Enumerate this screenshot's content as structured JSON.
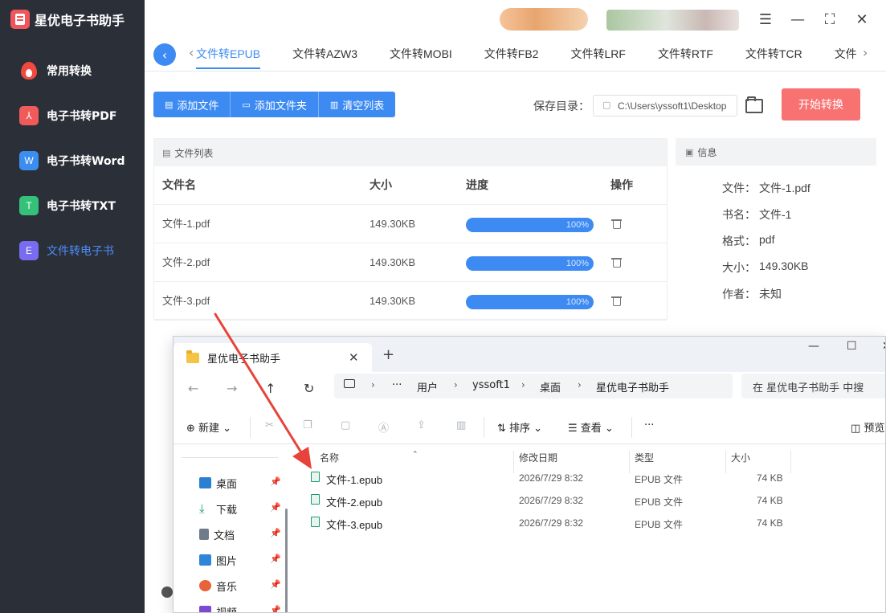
{
  "app": {
    "title": "星优电子书助手",
    "nav": [
      {
        "label": "常用转换",
        "icon": "fire-icon"
      },
      {
        "label": "电子书转PDF",
        "icon": "pdf-icon"
      },
      {
        "label": "电子书转Word",
        "icon": "word-icon",
        "glyph": "W"
      },
      {
        "label": "电子书转TXT",
        "icon": "txt-icon",
        "glyph": "T"
      },
      {
        "label": "文件转电子书",
        "icon": "ebook-icon",
        "glyph": "E",
        "active": true
      }
    ]
  },
  "tabs": [
    "文件转EPUB",
    "文件转AZW3",
    "文件转MOBI",
    "文件转FB2",
    "文件转LRF",
    "文件转RTF",
    "文件转TCR",
    "文件"
  ],
  "toolbar": {
    "add_file": "添加文件",
    "add_folder": "添加文件夹",
    "clear_list": "清空列表",
    "save_label": "保存目录：",
    "save_path": "C:\\Users\\yssoft1\\Desktop",
    "start": "开始转换"
  },
  "file_list": {
    "title": "文件列表",
    "columns": [
      "文件名",
      "大小",
      "进度",
      "操作"
    ],
    "rows": [
      {
        "name": "文件-1.pdf",
        "size": "149.30KB",
        "progress": 100,
        "progress_text": "100%"
      },
      {
        "name": "文件-2.pdf",
        "size": "149.30KB",
        "progress": 100,
        "progress_text": "100%"
      },
      {
        "name": "文件-3.pdf",
        "size": "149.30KB",
        "progress": 100,
        "progress_text": "100%"
      }
    ]
  },
  "info": {
    "title": "信息",
    "rows": [
      {
        "k": "文件：",
        "v": "文件-1.pdf"
      },
      {
        "k": "书名：",
        "v": "文件-1"
      },
      {
        "k": "格式：",
        "v": "pdf"
      },
      {
        "k": "大小：",
        "v": "149.30KB"
      },
      {
        "k": "作者：",
        "v": "未知"
      }
    ]
  },
  "explorer": {
    "tab_title": "星优电子书助手",
    "breadcrumb": [
      "用户",
      "yssoft1",
      "桌面",
      "星优电子书助手"
    ],
    "search_placeholder": "在 星优电子书助手 中搜",
    "new_label": "新建",
    "sort_label": "排序",
    "view_label": "查看",
    "more_label": "···",
    "preview_label": "预览",
    "quick_access": [
      {
        "label": "桌面",
        "color": "#2b7fd1"
      },
      {
        "label": "下载",
        "color": "#1c9a6e"
      },
      {
        "label": "文档",
        "color": "#6f7b89"
      },
      {
        "label": "图片",
        "color": "#2f86d8"
      },
      {
        "label": "音乐",
        "color": "#e8623a"
      },
      {
        "label": "视频",
        "color": "#7b4ad1"
      }
    ],
    "columns": [
      "名称",
      "修改日期",
      "类型",
      "大小"
    ],
    "files": [
      {
        "name": "文件-1.epub",
        "date": "2026/7/29 8:32",
        "type": "EPUB 文件",
        "size": "74 KB"
      },
      {
        "name": "文件-2.epub",
        "date": "2026/7/29 8:32",
        "type": "EPUB 文件",
        "size": "74 KB"
      },
      {
        "name": "文件-3.epub",
        "date": "2026/7/29 8:32",
        "type": "EPUB 文件",
        "size": "74 KB"
      }
    ]
  },
  "colors": {
    "accent": "#3d8bf2",
    "start_button": "#f87272",
    "sidebar_bg": "#2b2f38",
    "arrow": "#e8433a"
  }
}
